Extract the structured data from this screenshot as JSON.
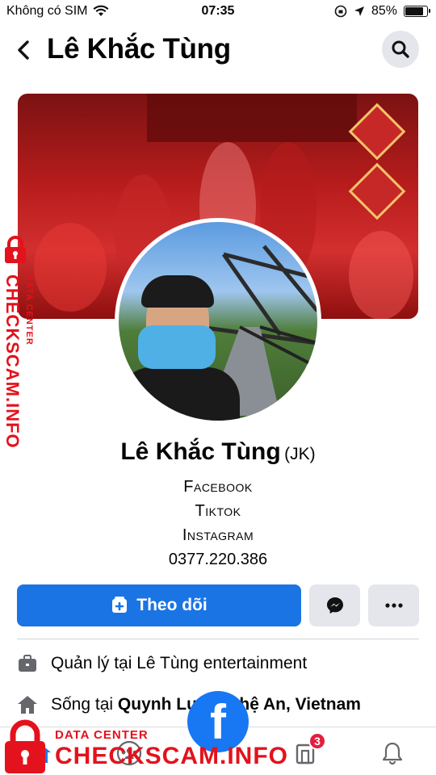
{
  "status_bar": {
    "carrier": "Không có SIM",
    "time": "07:35",
    "battery": "85%",
    "battery_level": 0.85
  },
  "header": {
    "title": "Lê Khắc Tùng"
  },
  "profile": {
    "name": "Lê Khắc Tùng",
    "nickname": "(JK)",
    "bio_lines": [
      "Facebook",
      "Tiktok",
      "Instagram",
      "0377.220.386"
    ]
  },
  "actions": {
    "follow_label": "Theo dõi"
  },
  "info": [
    {
      "prefix": "Quản lý tại ",
      "value": "Lê Tùng entertainment"
    },
    {
      "prefix": "Sống tại ",
      "value": "Quynh Luu, Nghệ An, Vietnam"
    }
  ],
  "tab_bar": {
    "notifications_badge": "3"
  },
  "watermark": {
    "brand": "CHECKSCAM.INFO",
    "tagline": "DATA CENTER",
    "fb_letter": "f"
  },
  "colors": {
    "accent": "#1b74e4",
    "watermark_red": "#e3121c",
    "button_gray": "#e4e6eb"
  }
}
